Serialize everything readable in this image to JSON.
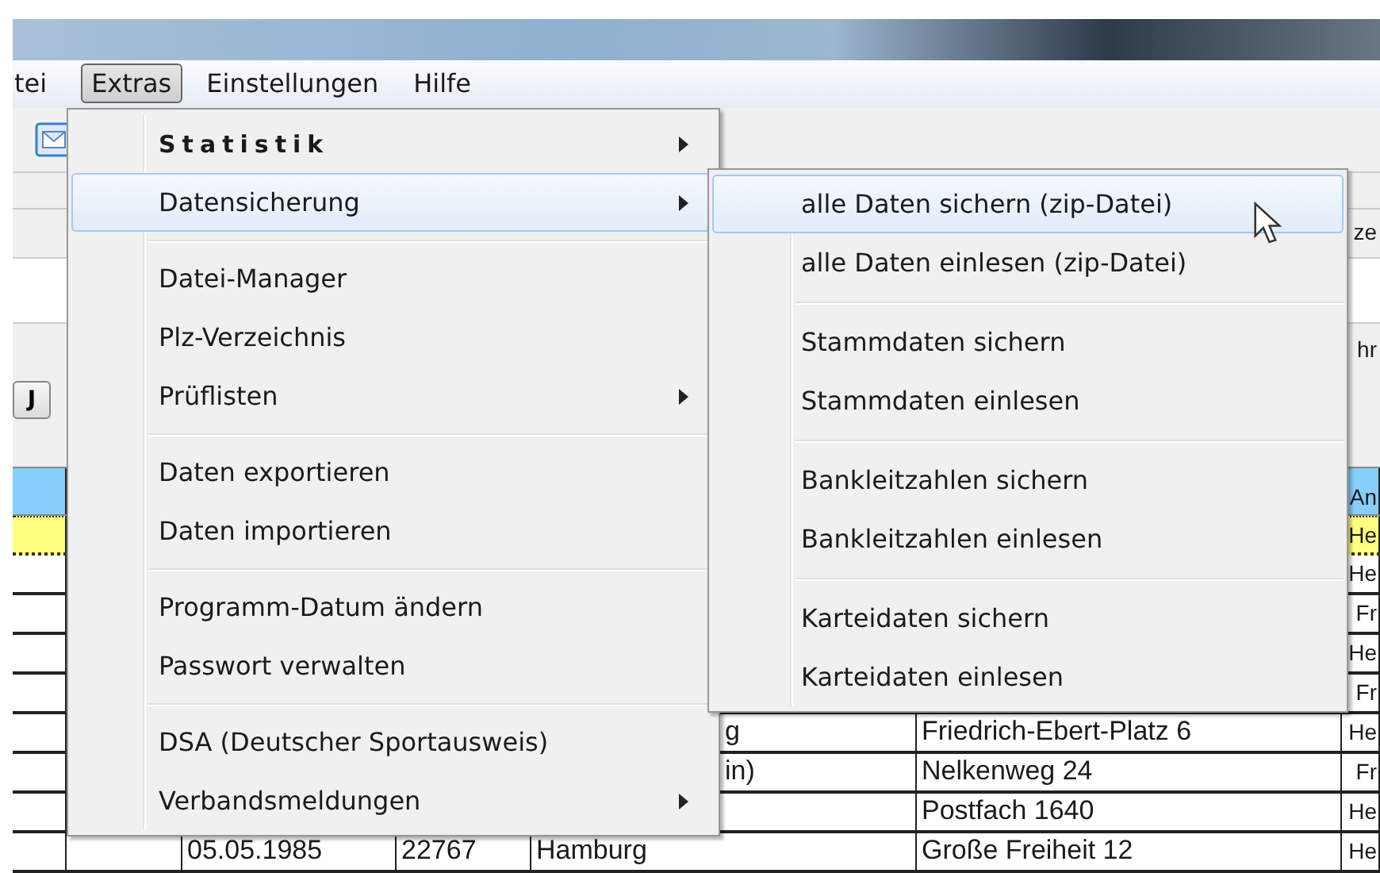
{
  "menu_bar": [
    {
      "label": "tei",
      "selected": false
    },
    {
      "label": "Extras",
      "selected": true
    },
    {
      "label": "Einstellungen",
      "selected": false
    },
    {
      "label": "Hilfe",
      "selected": false
    }
  ],
  "form": {
    "label_1": "ze",
    "label_2": "hr",
    "button": "J"
  },
  "table": {
    "header": {
      "column_8": "An"
    },
    "rows": [
      {
        "selected": true,
        "cells": {
          "column_8": "He"
        }
      },
      {
        "selected": false,
        "cells": {
          "column_8": "He"
        }
      },
      {
        "selected": false,
        "cells": {
          "column_8": "Fr"
        }
      },
      {
        "selected": false,
        "cells": {
          "column_8": "He"
        }
      },
      {
        "selected": false,
        "cells": {
          "column_8": "Fr"
        }
      },
      {
        "selected": false,
        "cells": {
          "column_6": "g",
          "column_7": "Friedrich-Ebert-Platz 6",
          "column_8": "He"
        }
      },
      {
        "selected": false,
        "cells": {
          "column_6": "in)",
          "column_7": "Nelkenweg 24",
          "column_8": "Fr"
        }
      },
      {
        "selected": false,
        "cells": {
          "column_7": "Postfach 1640",
          "column_8": "He"
        }
      },
      {
        "selected": false,
        "cells": {
          "column_3": "05.05.1985",
          "column_4": "22767",
          "column_5": "Hamburg",
          "column_7": "Große Freiheit 12",
          "column_8": "He"
        }
      }
    ]
  },
  "extras_menu": [
    {
      "kind": "item",
      "label": "Statistik",
      "letter_spaced": true,
      "submenu": true,
      "selected": false
    },
    {
      "kind": "item",
      "label": "Datensicherung",
      "letter_spaced": false,
      "submenu": true,
      "selected": true
    },
    {
      "kind": "separator"
    },
    {
      "kind": "item",
      "label": "Datei-Manager",
      "letter_spaced": false,
      "submenu": false,
      "selected": false
    },
    {
      "kind": "item",
      "label": "Plz-Verzeichnis",
      "letter_spaced": false,
      "submenu": false,
      "selected": false
    },
    {
      "kind": "item",
      "label": "Prüflisten",
      "letter_spaced": false,
      "submenu": true,
      "selected": false
    },
    {
      "kind": "separator"
    },
    {
      "kind": "item",
      "label": "Daten exportieren",
      "letter_spaced": false,
      "submenu": false,
      "selected": false
    },
    {
      "kind": "item",
      "label": "Daten importieren",
      "letter_spaced": false,
      "submenu": false,
      "selected": false
    },
    {
      "kind": "separator"
    },
    {
      "kind": "item",
      "label": "Programm-Datum ändern",
      "letter_spaced": false,
      "submenu": false,
      "selected": false
    },
    {
      "kind": "item",
      "label": "Passwort verwalten",
      "letter_spaced": false,
      "submenu": false,
      "selected": false
    },
    {
      "kind": "separator"
    },
    {
      "kind": "item",
      "label": "DSA (Deutscher Sportausweis)",
      "letter_spaced": false,
      "submenu": false,
      "selected": false
    },
    {
      "kind": "item",
      "label": "Verbandsmeldungen",
      "letter_spaced": false,
      "submenu": true,
      "selected": false
    }
  ],
  "datensicherung_submenu": [
    {
      "kind": "item",
      "label": "alle Daten sichern (zip-Datei)",
      "selected": true
    },
    {
      "kind": "item",
      "label": "alle Daten einlesen (zip-Datei)",
      "selected": false
    },
    {
      "kind": "separator"
    },
    {
      "kind": "item",
      "label": "Stammdaten sichern",
      "selected": false
    },
    {
      "kind": "item",
      "label": "Stammdaten einlesen",
      "selected": false
    },
    {
      "kind": "separator"
    },
    {
      "kind": "item",
      "label": "Bankleitzahlen sichern",
      "selected": false
    },
    {
      "kind": "item",
      "label": "Bankleitzahlen einlesen",
      "selected": false
    },
    {
      "kind": "separator"
    },
    {
      "kind": "item",
      "label": "Karteidaten sichern",
      "selected": false
    },
    {
      "kind": "item",
      "label": "Karteidaten einlesen",
      "selected": false
    }
  ]
}
